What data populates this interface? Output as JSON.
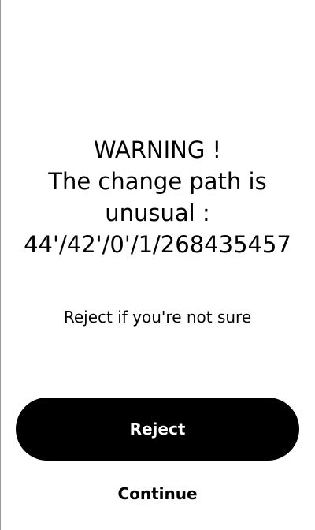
{
  "warning": {
    "line1": "WARNING !",
    "line2": "The change path is",
    "line3": "unusual :",
    "path": "44'/42'/0'/1/268435457"
  },
  "subtitle": "Reject if you're not sure",
  "actions": {
    "reject_label": "Reject",
    "continue_label": "Continue"
  },
  "colors": {
    "background": "#ffffff",
    "text": "#000000",
    "button_background": "#000000",
    "button_text": "#ffffff"
  }
}
